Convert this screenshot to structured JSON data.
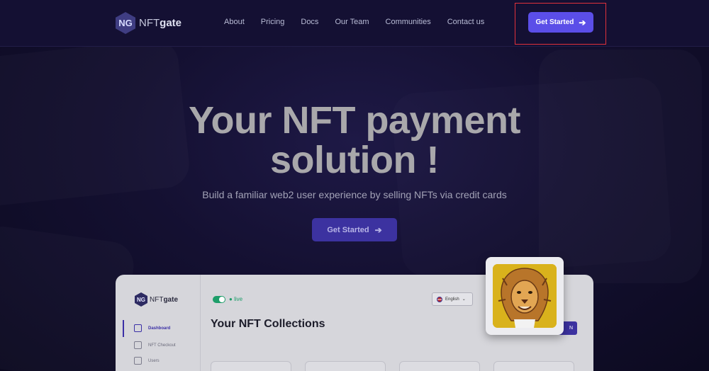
{
  "header": {
    "logo_mark": "NG",
    "logo_prefix": "NFT",
    "logo_suffix": "gate",
    "nav": [
      "About",
      "Pricing",
      "Docs",
      "Our Team",
      "Communities",
      "Contact us"
    ],
    "cta_label": "Get Started",
    "cta_icon": "arrow-right-icon",
    "highlight_color": "#e0313b"
  },
  "hero": {
    "title_line1": "Your NFT payment",
    "title_line2": "solution !",
    "subtitle": "Build a familiar web2 user experience by selling NFTs via credit cards",
    "cta_label": "Get Started"
  },
  "dashboard_preview": {
    "logo_mark": "NG",
    "logo_prefix": "NFT",
    "logo_suffix": "gate",
    "status": "live",
    "language": "English",
    "title": "Your NFT Collections",
    "sidebar": [
      {
        "label": "Dashboard",
        "icon": "grid-icon",
        "active": true
      },
      {
        "label": "NFT Checkout",
        "icon": "cart-icon",
        "active": false
      },
      {
        "label": "Users",
        "icon": "users-icon",
        "active": false
      }
    ],
    "button_label": "N"
  },
  "colors": {
    "accent": "#5b4ee8",
    "background": "#0e0b24",
    "live_green": "#1e9e6a"
  }
}
